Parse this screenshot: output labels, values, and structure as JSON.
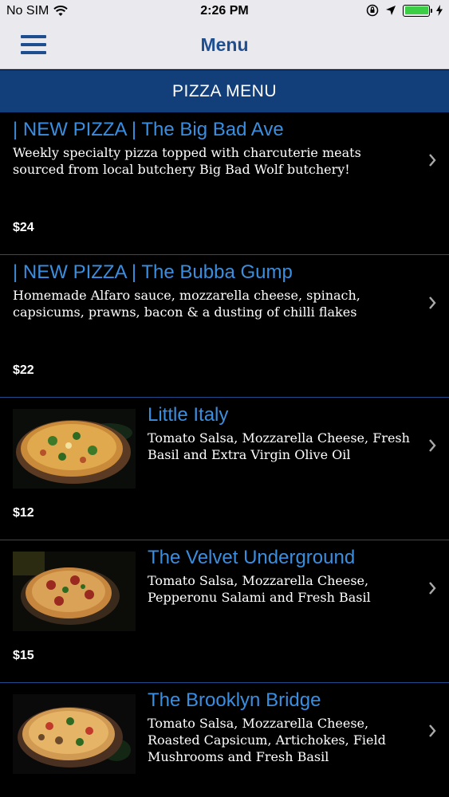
{
  "status": {
    "carrier": "No SIM",
    "time": "2:26 PM"
  },
  "nav": {
    "title": "Menu"
  },
  "section": {
    "title": "PIZZA MENU"
  },
  "items": [
    {
      "title": "| NEW PIZZA | The Big Bad Ave",
      "description": "Weekly specialty pizza topped with charcuterie meats sourced from local butchery Big Bad Wolf butchery!",
      "price": "$24"
    },
    {
      "title": "| NEW PIZZA | The Bubba Gump",
      "description": "Homemade Alfaro sauce, mozzarella cheese, spinach, capsicums, prawns, bacon & a dusting of chilli flakes",
      "price": "$22"
    },
    {
      "title": "Little Italy",
      "description": "Tomato Salsa, Mozzarella Cheese, Fresh Basil and Extra Virgin Olive Oil",
      "price": "$12"
    },
    {
      "title": "The Velvet Underground",
      "description": "Tomato Salsa, Mozzarella Cheese, Pepperonu Salami and Fresh Basil",
      "price": "$15"
    },
    {
      "title": "The Brooklyn Bridge",
      "description": "Tomato Salsa, Mozzarella Cheese, Roasted Capsicum, Artichokes, Field Mushrooms and Fresh Basil",
      "price": ""
    }
  ],
  "colors": {
    "nav_bar": "#e9e9ee",
    "nav_title": "#1f4f91",
    "section_header": "#123e7a",
    "item_title": "#3a8ee0",
    "divider": "#1f4c8a",
    "battery": "#3ccf45"
  },
  "icons": [
    "wifi-icon",
    "orientation-lock-icon",
    "location-arrow-icon",
    "battery-icon",
    "charging-icon",
    "hamburger-menu-icon",
    "chevron-right-icon",
    "pizza-photo"
  ]
}
